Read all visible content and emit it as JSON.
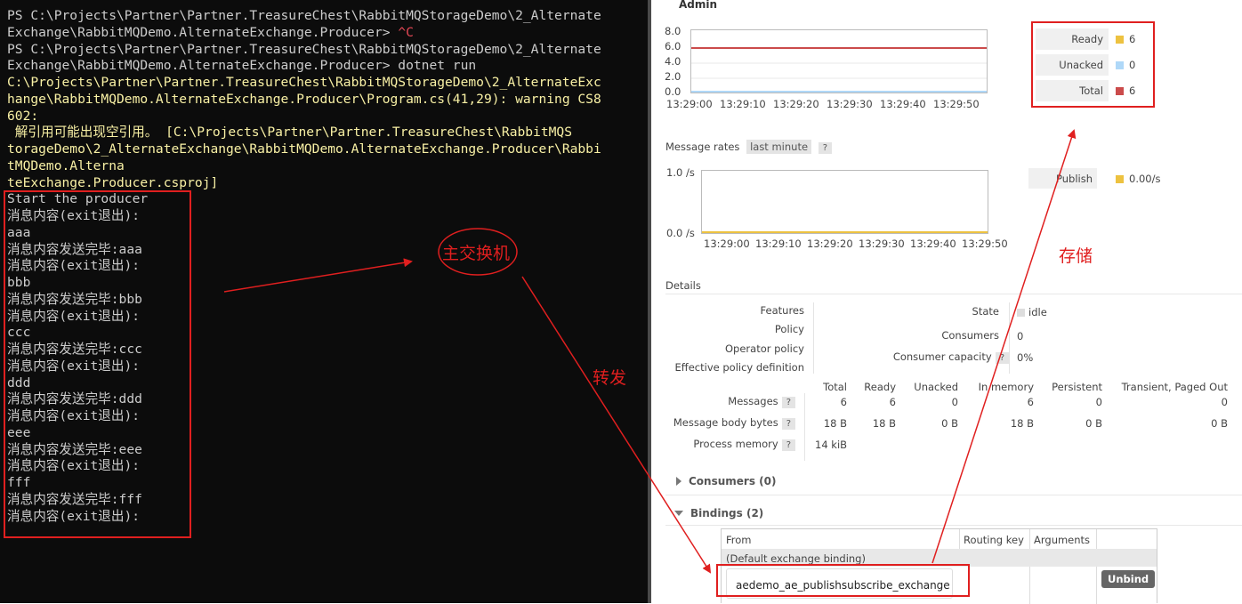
{
  "terminal": {
    "lines": [
      {
        "text": "PS C:\\Projects\\Partner\\Partner.TreasureChest\\RabbitMQStorageDemo\\2_Alternate",
        "color": "default"
      },
      {
        "text": "Exchange\\RabbitMQDemo.AlternateExchange.Producer> ",
        "suffix": "^C",
        "color": "default"
      },
      {
        "text": "PS C:\\Projects\\Partner\\Partner.TreasureChest\\RabbitMQStorageDemo\\2_Alternate",
        "color": "default"
      },
      {
        "text": "Exchange\\RabbitMQDemo.AlternateExchange.Producer> dotnet run",
        "color": "default"
      },
      {
        "text": "C:\\Projects\\Partner\\Partner.TreasureChest\\RabbitMQStorageDemo\\2_AlternateExc",
        "color": "yellow"
      },
      {
        "text": "hange\\RabbitMQDemo.AlternateExchange.Producer\\Program.cs(41,29): warning CS8",
        "color": "yellow"
      },
      {
        "text": "602:",
        "color": "yellow"
      },
      {
        "text": " 解引用可能出现空引用。 [C:\\Projects\\Partner\\Partner.TreasureChest\\RabbitMQS",
        "color": "yellow"
      },
      {
        "text": "torageDemo\\2_AlternateExchange\\RabbitMQDemo.AlternateExchange.Producer\\Rabbi",
        "color": "yellow"
      },
      {
        "text": "tMQDemo.Alterna",
        "color": "yellow"
      },
      {
        "text": "teExchange.Producer.csproj]",
        "color": "yellow"
      },
      {
        "text": "Start the producer",
        "color": "default"
      },
      {
        "text": "消息内容(exit退出):",
        "color": "default"
      },
      {
        "text": "aaa",
        "color": "default"
      },
      {
        "text": "消息内容发送完毕:aaa",
        "color": "default"
      },
      {
        "text": "消息内容(exit退出):",
        "color": "default"
      },
      {
        "text": "bbb",
        "color": "default"
      },
      {
        "text": "消息内容发送完毕:bbb",
        "color": "default"
      },
      {
        "text": "消息内容(exit退出):",
        "color": "default"
      },
      {
        "text": "ccc",
        "color": "default"
      },
      {
        "text": "消息内容发送完毕:ccc",
        "color": "default"
      },
      {
        "text": "消息内容(exit退出):",
        "color": "default"
      },
      {
        "text": "ddd",
        "color": "default"
      },
      {
        "text": "消息内容发送完毕:ddd",
        "color": "default"
      },
      {
        "text": "消息内容(exit退出):",
        "color": "default"
      },
      {
        "text": "eee",
        "color": "default"
      },
      {
        "text": "消息内容发送完毕:eee",
        "color": "default"
      },
      {
        "text": "消息内容(exit退出):",
        "color": "default"
      },
      {
        "text": "fff",
        "color": "default"
      },
      {
        "text": "消息内容发送完毕:fff",
        "color": "default"
      },
      {
        "text": "消息内容(exit退出):",
        "color": "default"
      }
    ]
  },
  "queue": {
    "admin_tab": "Admin",
    "queued_chart": {
      "y_ticks": [
        "8.0",
        "6.0",
        "4.0",
        "2.0",
        "0.0"
      ],
      "x_ticks": [
        "13:29:00",
        "13:29:10",
        "13:29:20",
        "13:29:30",
        "13:29:40",
        "13:29:50"
      ]
    },
    "queued_legend": [
      {
        "label": "Ready",
        "value": "6",
        "color": "#edc240"
      },
      {
        "label": "Unacked",
        "value": "0",
        "color": "#afd8f8"
      },
      {
        "label": "Total",
        "value": "6",
        "color": "#cb4b4b"
      }
    ],
    "message_rates": {
      "title": "Message rates",
      "range": "last minute",
      "help": "?",
      "y_ticks": [
        "1.0 /s",
        "0.0 /s"
      ],
      "x_ticks": [
        "13:29:00",
        "13:29:10",
        "13:29:20",
        "13:29:30",
        "13:29:40",
        "13:29:50"
      ],
      "legend": {
        "label": "Publish",
        "value": "0.00/s",
        "color": "#edc240"
      }
    },
    "details": {
      "title": "Details",
      "left_labels": [
        "Features",
        "Policy",
        "Operator policy",
        "Effective policy definition"
      ],
      "state_label": "State",
      "state_value": "idle",
      "consumers_label": "Consumers",
      "consumers_value": "0",
      "consumer_capacity_label": "Consumer capacity",
      "consumer_capacity_value": "0%",
      "help": "?",
      "columns": [
        "Total",
        "Ready",
        "Unacked",
        "In memory",
        "Persistent",
        "Transient, Paged Out"
      ],
      "rows": [
        {
          "label": "Messages",
          "values": [
            "6",
            "6",
            "0",
            "6",
            "0",
            "0"
          ]
        },
        {
          "label": "Message body bytes",
          "values": [
            "18 B",
            "18 B",
            "0 B",
            "18 B",
            "0 B",
            "0 B"
          ]
        },
        {
          "label": "Process memory",
          "values": [
            "14 kiB"
          ]
        }
      ]
    },
    "consumers_section": "Consumers (0)",
    "bindings_section": "Bindings (2)",
    "bindings_table": {
      "columns": [
        "From",
        "Routing key",
        "Arguments"
      ],
      "default_binding": "(Default exchange binding)",
      "exchange_name": "aedemo_ae_publishsubscribe_exchange",
      "unbind_label": "Unbind"
    }
  },
  "annotations": {
    "main_exchange": "主交换机",
    "forward": "转发",
    "store": "存储",
    "color": "#e01f1f"
  }
}
